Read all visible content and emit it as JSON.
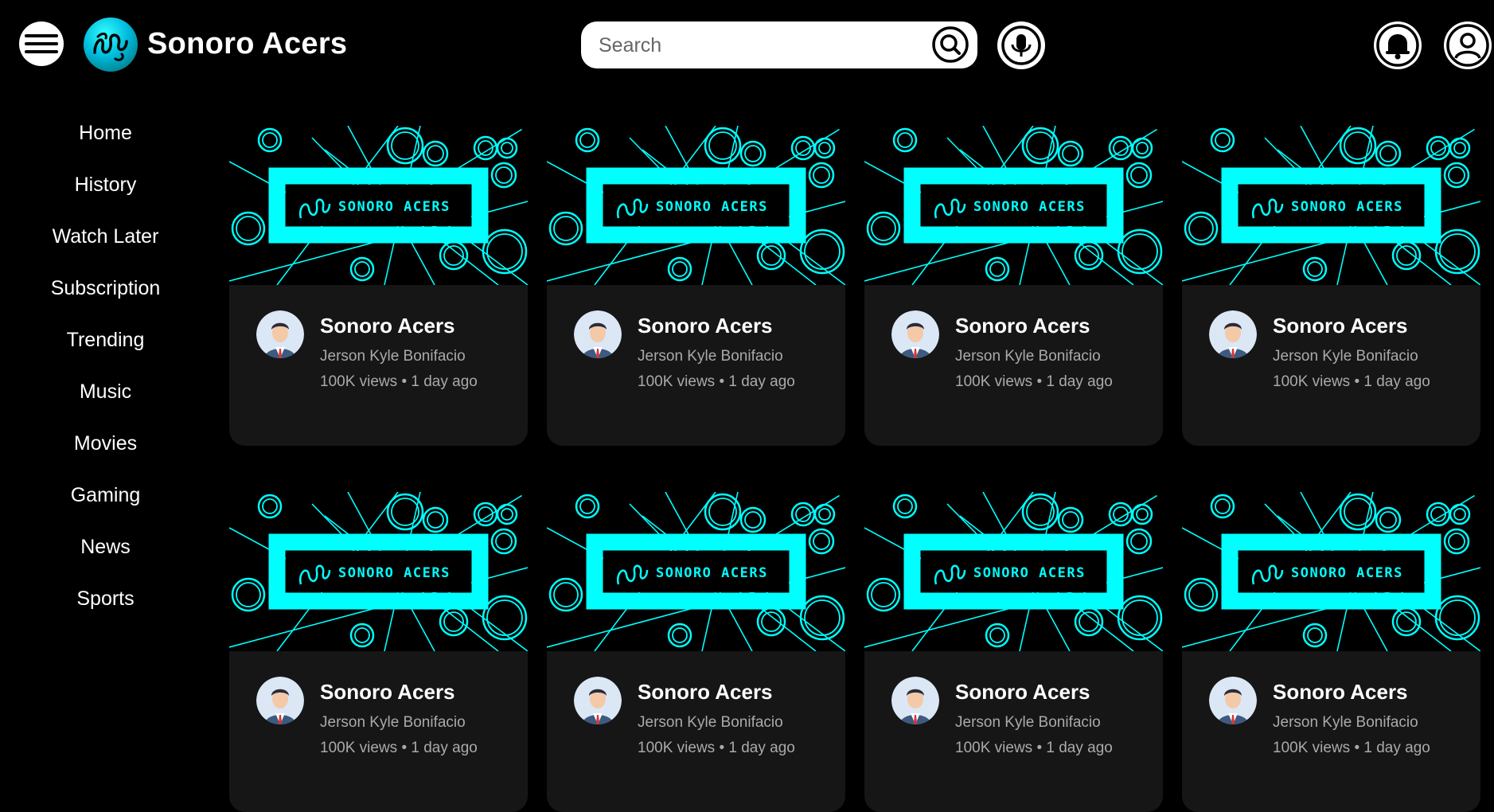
{
  "header": {
    "app_title": "Sonoro Acers",
    "search_placeholder": "Search",
    "icons": [
      "menu-icon",
      "logo-icon",
      "search-icon",
      "mic-icon",
      "bell-icon",
      "account-icon"
    ]
  },
  "sidebar": {
    "items": [
      {
        "label": "Home"
      },
      {
        "label": "History"
      },
      {
        "label": "Watch Later"
      },
      {
        "label": "Subscription"
      },
      {
        "label": "Trending"
      },
      {
        "label": "Music"
      },
      {
        "label": "Movies"
      },
      {
        "label": "Gaming"
      },
      {
        "label": "News"
      },
      {
        "label": "Sports"
      }
    ]
  },
  "videos": [
    {
      "title": "Sonoro Acers",
      "channel": "Jerson Kyle Bonifacio",
      "meta": "100K views • 1 day ago",
      "thumb_text": "SONORO ACERS"
    },
    {
      "title": "Sonoro Acers",
      "channel": "Jerson Kyle Bonifacio",
      "meta": "100K views • 1 day ago",
      "thumb_text": "SONORO ACERS"
    },
    {
      "title": "Sonoro Acers",
      "channel": "Jerson Kyle Bonifacio",
      "meta": "100K views • 1 day ago",
      "thumb_text": "SONORO ACERS"
    },
    {
      "title": "Sonoro Acers",
      "channel": "Jerson Kyle Bonifacio",
      "meta": "100K views • 1 day ago",
      "thumb_text": "SONORO ACERS"
    },
    {
      "title": "Sonoro Acers",
      "channel": "Jerson Kyle Bonifacio",
      "meta": "100K views • 1 day ago",
      "thumb_text": "SONORO ACERS"
    },
    {
      "title": "Sonoro Acers",
      "channel": "Jerson Kyle Bonifacio",
      "meta": "100K views • 1 day ago",
      "thumb_text": "SONORO ACERS"
    },
    {
      "title": "Sonoro Acers",
      "channel": "Jerson Kyle Bonifacio",
      "meta": "100K views • 1 day ago",
      "thumb_text": "SONORO ACERS"
    },
    {
      "title": "Sonoro Acers",
      "channel": "Jerson Kyle Bonifacio",
      "meta": "100K views • 1 day ago",
      "thumb_text": "SONORO ACERS"
    }
  ],
  "colors": {
    "background": "#000000",
    "accent": "#00ffff",
    "card": "#161616",
    "muted_text": "#aaaaaa"
  }
}
